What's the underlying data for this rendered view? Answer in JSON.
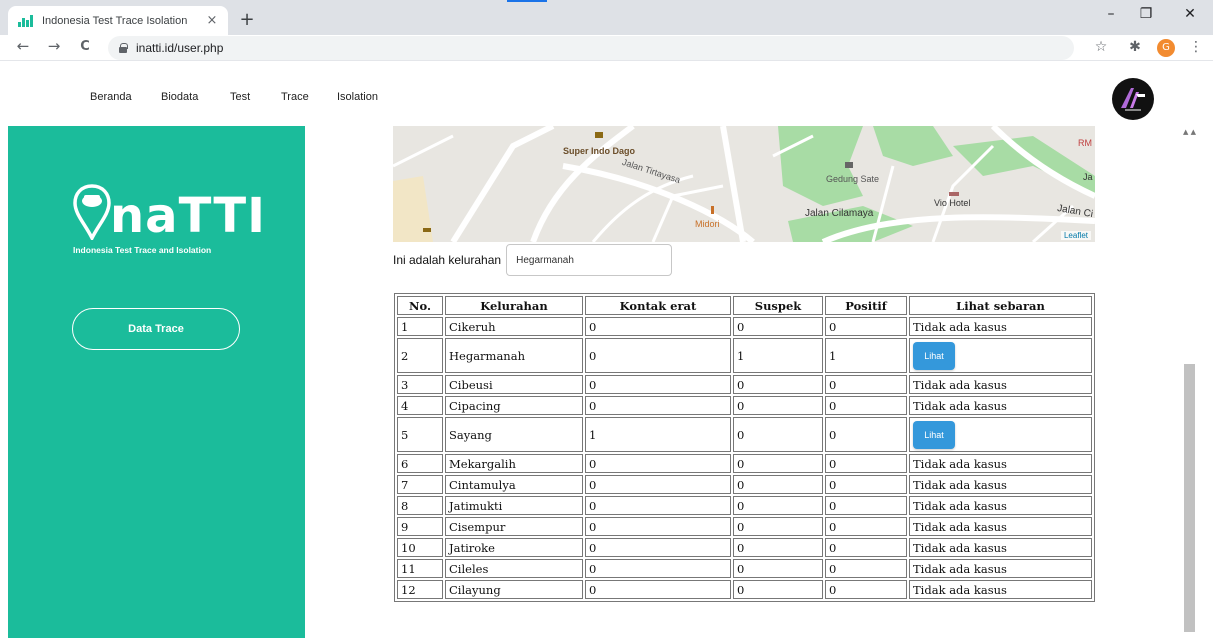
{
  "browser": {
    "tab_title": "Indonesia Test Trace Isolation",
    "tab_close": "×",
    "new_tab": "+",
    "url_host": "inatti.id",
    "url_path": "/user.php",
    "profile_initial": "G",
    "controls": {
      "minimize": "–",
      "restore": "❐",
      "close": "✕"
    },
    "nav": {
      "back": "←",
      "forward": "→",
      "reload": "C"
    },
    "icons": {
      "star": "☆",
      "extensions": "✱",
      "menu": "⋮"
    }
  },
  "site_nav": {
    "links": [
      "Beranda",
      "Biodata",
      "Test",
      "Trace",
      "Isolation"
    ]
  },
  "sidebar": {
    "logo_text": "naTTI",
    "logo_subtitle": "Indonesia Test Trace and Isolation",
    "button_label": "Data Trace"
  },
  "map": {
    "labels": {
      "super_indo": "Super Indo Dago",
      "jalan_tirtayasa": "Jalan Tirtayasa",
      "midori": "Midori",
      "gedung_sate": "Gedung Sate",
      "jalan_cilamaya": "Jalan Cilamaya",
      "vio_hotel": "Vio Hotel",
      "jalan_ci": "Jalan Ci",
      "rm": "RM",
      "ja": "Ja"
    },
    "attribution": "Leaflet"
  },
  "kelurahan": {
    "label": "Ini adalah kelurahan",
    "value": "Hegarmanah"
  },
  "table": {
    "headers": [
      "No.",
      "Kelurahan",
      "Kontak erat",
      "Suspek",
      "Positif",
      "Lihat sebaran"
    ],
    "button_label": "Lihat",
    "rows": [
      {
        "no": "1",
        "kelurahan": "Cikeruh",
        "kontak": "0",
        "suspek": "0",
        "positif": "0",
        "sebaran": "Tidak ada kasus"
      },
      {
        "no": "2",
        "kelurahan": "Hegarmanah",
        "kontak": "0",
        "suspek": "1",
        "positif": "1",
        "sebaran": "Lihat"
      },
      {
        "no": "3",
        "kelurahan": "Cibeusi",
        "kontak": "0",
        "suspek": "0",
        "positif": "0",
        "sebaran": "Tidak ada kasus"
      },
      {
        "no": "4",
        "kelurahan": "Cipacing",
        "kontak": "0",
        "suspek": "0",
        "positif": "0",
        "sebaran": "Tidak ada kasus"
      },
      {
        "no": "5",
        "kelurahan": "Sayang",
        "kontak": "1",
        "suspek": "0",
        "positif": "0",
        "sebaran": "Lihat"
      },
      {
        "no": "6",
        "kelurahan": "Mekargalih",
        "kontak": "0",
        "suspek": "0",
        "positif": "0",
        "sebaran": "Tidak ada kasus"
      },
      {
        "no": "7",
        "kelurahan": "Cintamulya",
        "kontak": "0",
        "suspek": "0",
        "positif": "0",
        "sebaran": "Tidak ada kasus"
      },
      {
        "no": "8",
        "kelurahan": "Jatimukti",
        "kontak": "0",
        "suspek": "0",
        "positif": "0",
        "sebaran": "Tidak ada kasus"
      },
      {
        "no": "9",
        "kelurahan": "Cisempur",
        "kontak": "0",
        "suspek": "0",
        "positif": "0",
        "sebaran": "Tidak ada kasus"
      },
      {
        "no": "10",
        "kelurahan": "Jatiroke",
        "kontak": "0",
        "suspek": "0",
        "positif": "0",
        "sebaran": "Tidak ada kasus"
      },
      {
        "no": "11",
        "kelurahan": "Cileles",
        "kontak": "0",
        "suspek": "0",
        "positif": "0",
        "sebaran": "Tidak ada kasus"
      },
      {
        "no": "12",
        "kelurahan": "Cilayung",
        "kontak": "0",
        "suspek": "0",
        "positif": "0",
        "sebaran": "Tidak ada kasus"
      }
    ]
  },
  "colors": {
    "brand_teal": "#1bbc9b",
    "button_blue": "#3498db"
  }
}
